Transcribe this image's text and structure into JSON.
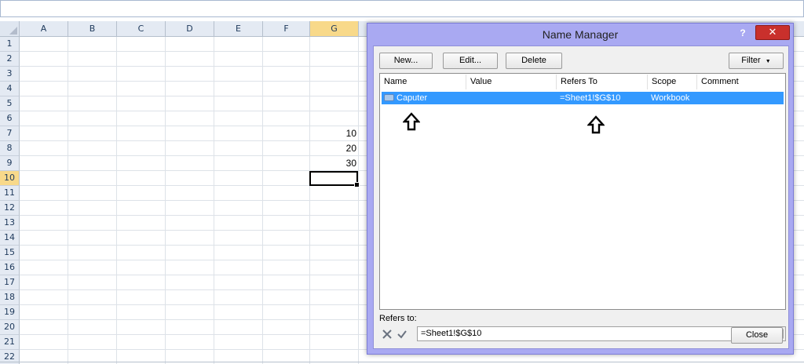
{
  "spreadsheet": {
    "columns": [
      "A",
      "B",
      "C",
      "D",
      "E",
      "F",
      "G"
    ],
    "rows": [
      "1",
      "2",
      "3",
      "4",
      "5",
      "6",
      "7",
      "8",
      "9",
      "10",
      "11",
      "12",
      "13",
      "14",
      "15",
      "16",
      "17",
      "18",
      "19",
      "20",
      "21",
      "22"
    ],
    "cells": {
      "g7": "10",
      "g8": "20",
      "g9": "30"
    }
  },
  "dialog": {
    "title": "Name Manager",
    "help": "?",
    "close_glyph": "✕",
    "buttons": {
      "new": "New...",
      "edit": "Edit...",
      "delete": "Delete",
      "filter": "Filter",
      "close": "Close"
    },
    "columns": {
      "name": "Name",
      "value": "Value",
      "refers_to": "Refers To",
      "scope": "Scope",
      "comment": "Comment"
    },
    "row": {
      "name": "Caputer",
      "value": "",
      "refers_to": "=Sheet1!$G$10",
      "scope": "Workbook",
      "comment": ""
    },
    "refers_to_label": "Refers to:",
    "refers_to_value": "=Sheet1!$G$10"
  },
  "colors": {
    "dialog_frame": "#a9a9f2",
    "selection": "#3399ff",
    "close_button": "#c9302c",
    "header_highlight": "#f8d98a"
  }
}
